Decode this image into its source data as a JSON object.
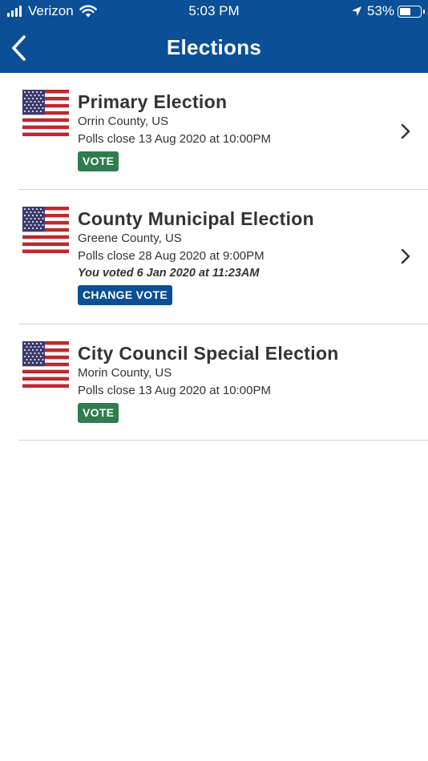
{
  "status_bar": {
    "carrier": "Verizon",
    "time": "5:03 PM",
    "battery_percent": "53%",
    "battery_level": 0.53,
    "icons": [
      "signal-icon",
      "wifi-icon",
      "location-arrow-icon",
      "battery-icon"
    ]
  },
  "header": {
    "title": "Elections",
    "back_icon": "chevron-left-icon",
    "background_color": "#0b4f96"
  },
  "elections": [
    {
      "title": "Primary Election",
      "location": "Orrin County, US",
      "polls": "Polls close 13 Aug 2020 at 10:00PM",
      "voted": "",
      "action": "VOTE",
      "has_chevron": true
    },
    {
      "title": "County Municipal Election",
      "location": "Greene County, US",
      "polls": "Polls close 28 Aug 2020 at 9:00PM",
      "voted": "You voted 6 Jan 2020 at 11:23AM",
      "action": "CHANGE VOTE",
      "has_chevron": true
    },
    {
      "title": "City Council Special Election",
      "location": "Morin County, US",
      "polls": "Polls close 13 Aug 2020 at 10:00PM",
      "voted": "",
      "action": "VOTE",
      "has_chevron": false
    }
  ],
  "colors": {
    "vote_badge": "#2f7d4f",
    "change_vote_badge": "#0b4f96"
  }
}
